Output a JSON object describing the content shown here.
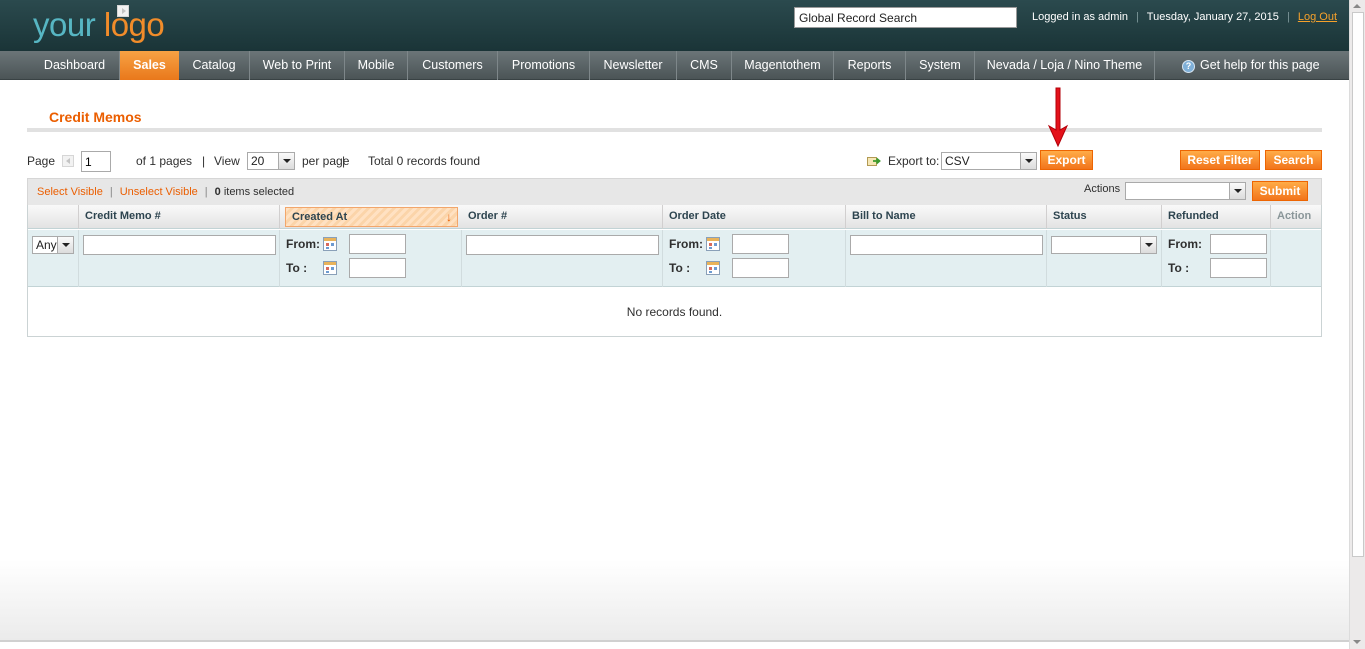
{
  "header": {
    "logo_part1": "your",
    "logo_part2": "logo",
    "search_value": "Global Record Search",
    "logged_in": "Logged in as admin",
    "date": "Tuesday, January 27, 2015",
    "logout": "Log Out",
    "separator": "|"
  },
  "nav": {
    "items": [
      {
        "label": "Dashboard"
      },
      {
        "label": "Sales"
      },
      {
        "label": "Catalog"
      },
      {
        "label": "Web to Print"
      },
      {
        "label": "Mobile"
      },
      {
        "label": "Customers"
      },
      {
        "label": "Promotions"
      },
      {
        "label": "Newsletter"
      },
      {
        "label": "CMS"
      },
      {
        "label": "Magentothem"
      },
      {
        "label": "Reports"
      },
      {
        "label": "System"
      },
      {
        "label": "Nevada / Loja / Nino Theme"
      }
    ],
    "active": "Sales",
    "help": "Get help for this page"
  },
  "page": {
    "title": "Credit Memos"
  },
  "pager": {
    "page_label": "Page",
    "page_value": "1",
    "of_pages": "of 1 pages",
    "view_label": "View",
    "view_value": "20",
    "per_page": "per page",
    "total": "Total 0 records found",
    "separator": "|"
  },
  "export": {
    "label": "Export to:",
    "format": "CSV",
    "button": "Export"
  },
  "buttons": {
    "reset_filter": "Reset Filter",
    "search": "Search",
    "submit": "Submit"
  },
  "massaction": {
    "select_visible": "Select Visible",
    "unselect_visible": "Unselect Visible",
    "items_selected_count": "0",
    "items_selected_text": "items selected",
    "actions_label": "Actions",
    "separator": "|"
  },
  "grid": {
    "columns": [
      {
        "label": ""
      },
      {
        "label": "Credit Memo #"
      },
      {
        "label": "Created At"
      },
      {
        "label": "Order #"
      },
      {
        "label": "Order Date"
      },
      {
        "label": "Bill to Name"
      },
      {
        "label": "Status"
      },
      {
        "label": "Refunded"
      },
      {
        "label": "Action"
      }
    ],
    "sorted_column": "Created At",
    "sort_arrow": "↓",
    "filters": {
      "any": "Any",
      "from": "From:",
      "to": "To :"
    },
    "empty_text": "No records found."
  },
  "colors": {
    "accent": "#eb5e00",
    "header_bg": "#2b4a4e",
    "nav_bg": "#5b6466",
    "filter_bg": "#e3eff1",
    "button_orange": "#f2741b"
  },
  "icons": {
    "help": "help-icon",
    "export": "export-icon",
    "calendar": "calendar-icon",
    "annotation": "red-arrow-icon"
  }
}
